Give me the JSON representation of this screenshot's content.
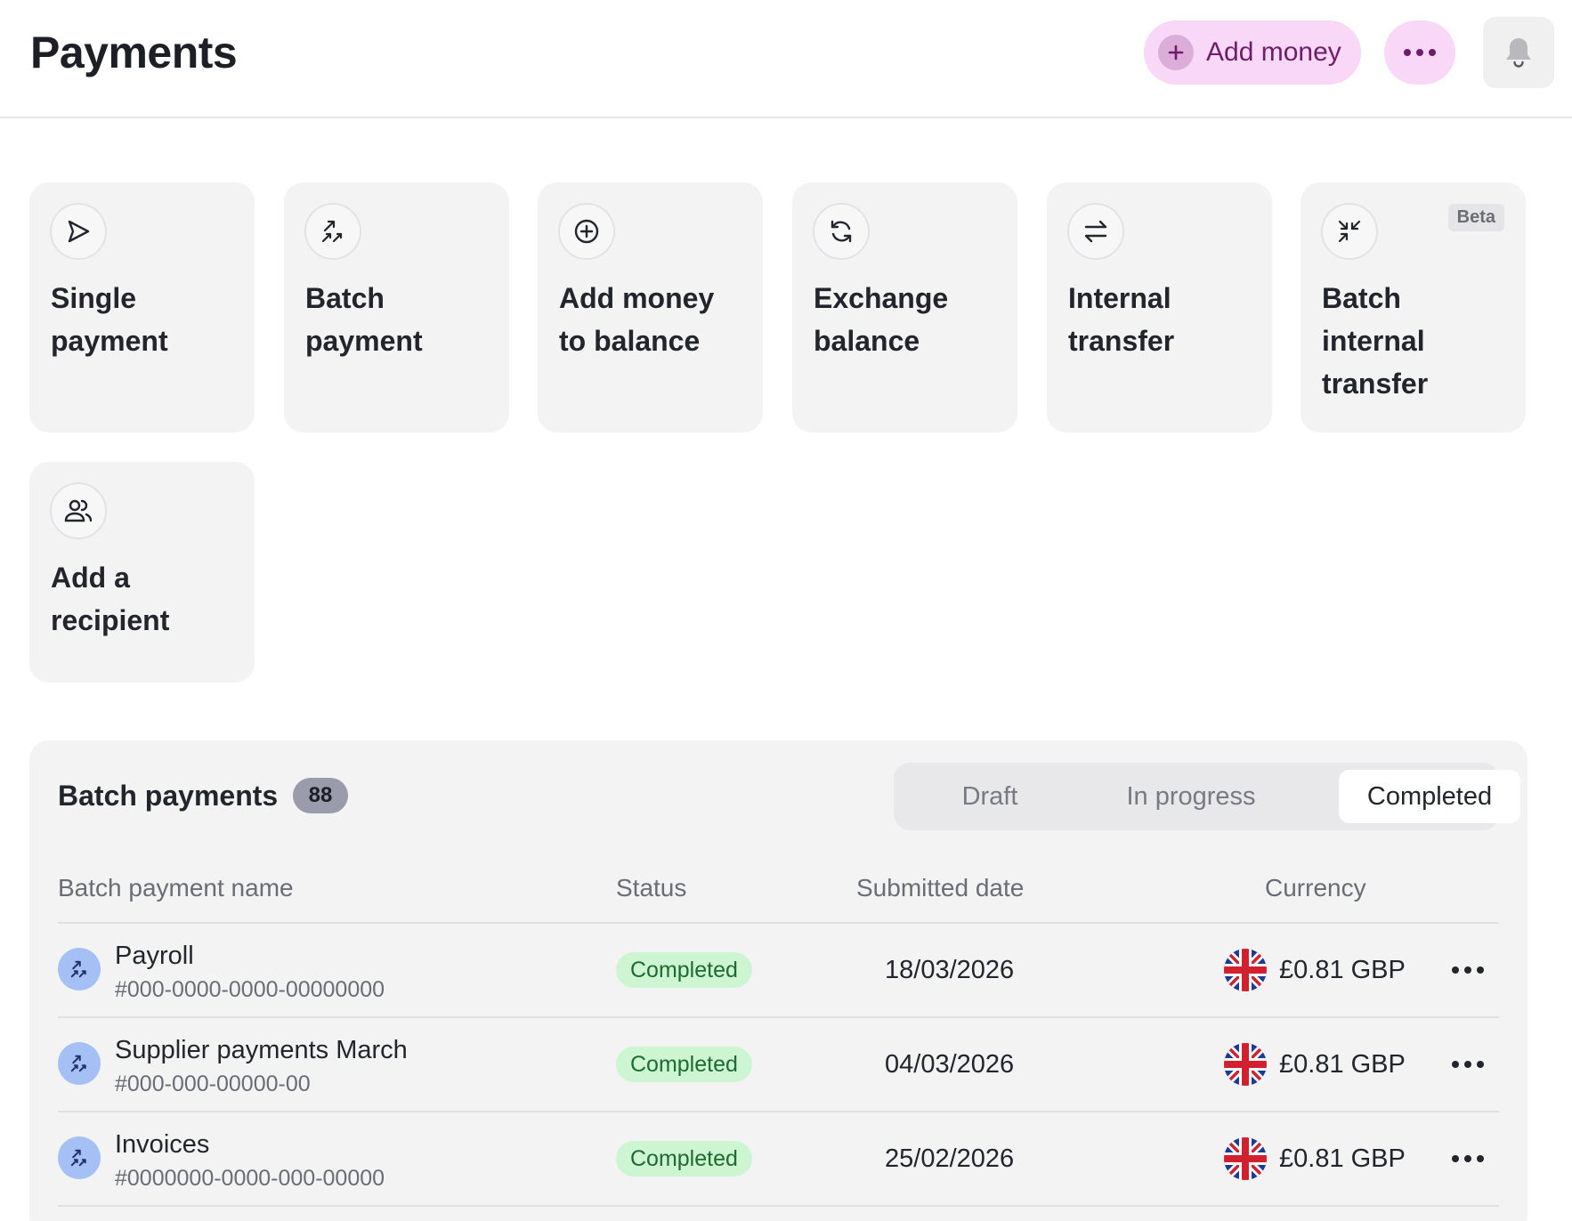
{
  "header": {
    "title": "Payments",
    "add_money_label": "Add money"
  },
  "tiles": [
    {
      "label": "Single\npayment",
      "icon": "send-icon"
    },
    {
      "label": "Batch\npayment",
      "icon": "batch-arrows-icon"
    },
    {
      "label": "Add money\nto balance",
      "icon": "plus-circle-icon"
    },
    {
      "label": "Exchange\nbalance",
      "icon": "refresh-icon"
    },
    {
      "label": "Internal\ntransfer",
      "icon": "swap-arrows-icon"
    },
    {
      "label": "Batch\ninternal\ntransfer",
      "icon": "compress-arrows-icon",
      "badge": "Beta"
    },
    {
      "label": "Add a\nrecipient",
      "icon": "users-icon"
    }
  ],
  "batch": {
    "title": "Batch payments",
    "count": "88",
    "tabs": [
      "Draft",
      "In progress",
      "Completed"
    ],
    "active_tab": "Completed",
    "columns": {
      "name": "Batch payment name",
      "status": "Status",
      "date": "Submitted date",
      "currency": "Currency"
    },
    "rows": [
      {
        "name": "Payroll",
        "ref": "#000-0000-0000-00000000",
        "status": "Completed",
        "date": "18/03/2026",
        "amount": "£0.81 GBP"
      },
      {
        "name": "Supplier payments March",
        "ref": "#000-000-00000-00",
        "status": "Completed",
        "date": "04/03/2026",
        "amount": "£0.81 GBP"
      },
      {
        "name": "Invoices",
        "ref": "#0000000-0000-000-00000",
        "status": "Completed",
        "date": "25/02/2026",
        "amount": "£0.81 GBP"
      }
    ]
  },
  "colors": {
    "accent_pink": "#f8d8f6",
    "accent_text": "#6e1d6a",
    "status_green_bg": "#cdf5d2",
    "status_green_text": "#1d6b2f",
    "row_icon_blue": "#a4c0f5"
  }
}
